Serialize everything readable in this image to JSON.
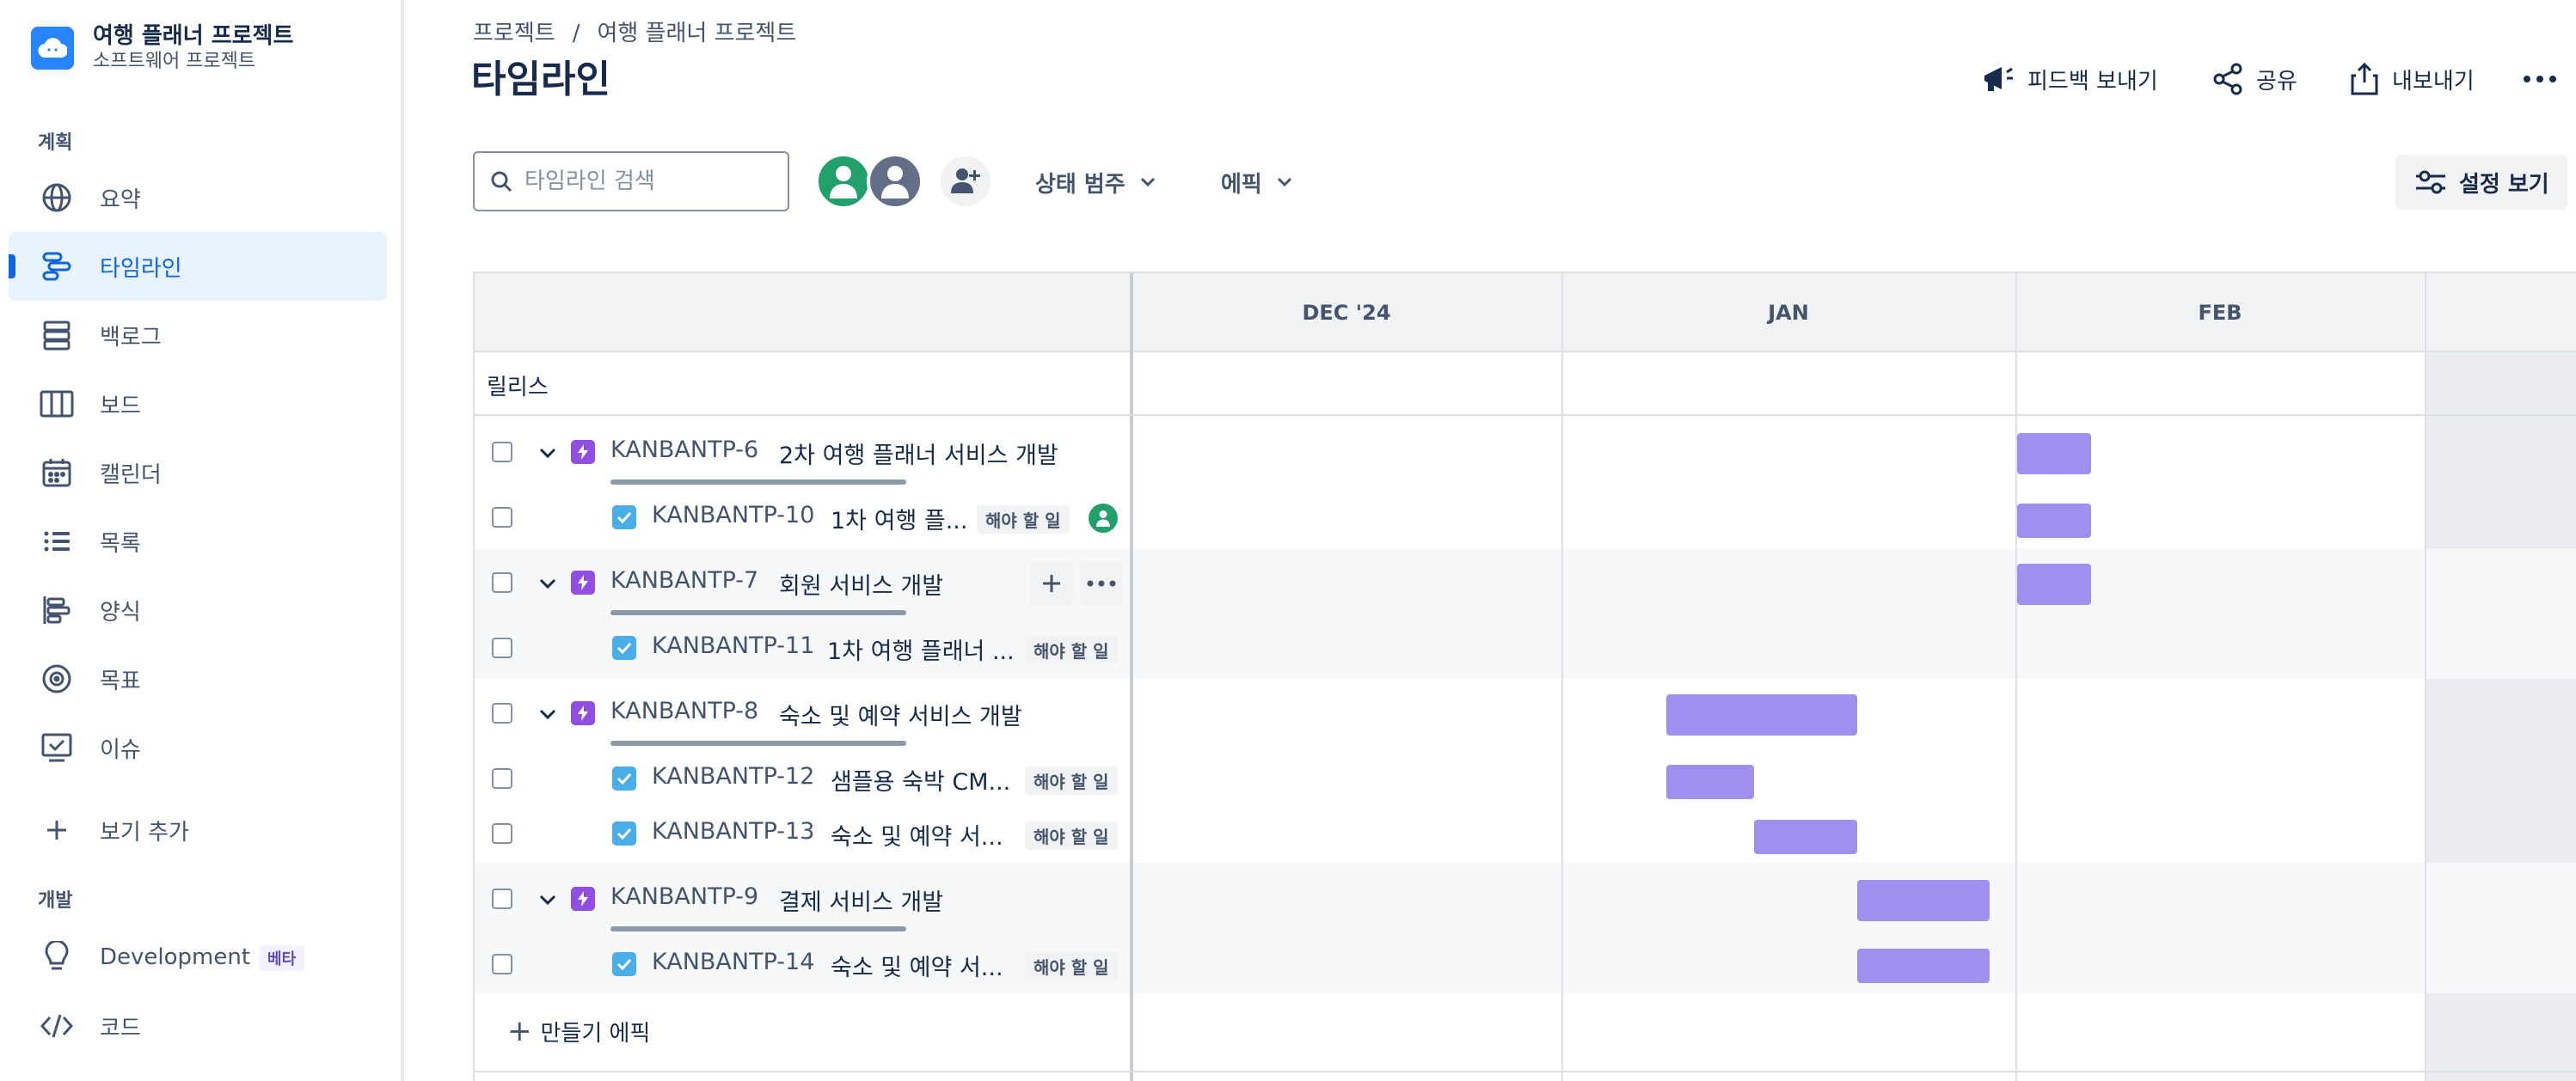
{
  "project": {
    "name": "여행 플래너 프로젝트",
    "type": "소프트웨어 프로젝트"
  },
  "sidebar": {
    "sections": {
      "plan": "계획",
      "dev": "개발"
    },
    "items": [
      {
        "label": "요약",
        "icon": "globe-icon"
      },
      {
        "label": "타임라인",
        "icon": "timeline-icon",
        "active": true
      },
      {
        "label": "백로그",
        "icon": "backlog-icon"
      },
      {
        "label": "보드",
        "icon": "board-icon"
      },
      {
        "label": "캘린더",
        "icon": "calendar-icon"
      },
      {
        "label": "목록",
        "icon": "list-icon"
      },
      {
        "label": "양식",
        "icon": "form-icon"
      },
      {
        "label": "목표",
        "icon": "target-icon"
      },
      {
        "label": "이슈",
        "icon": "issues-icon"
      }
    ],
    "add_view": "보기 추가",
    "dev_items": [
      {
        "label": "Development",
        "badge": "베타",
        "icon": "lightbulb-icon"
      },
      {
        "label": "코드",
        "icon": "code-icon"
      }
    ]
  },
  "breadcrumb": {
    "root": "프로젝트",
    "separator": "/",
    "current": "여행 플래너 프로젝트"
  },
  "page_title": "타임라인",
  "header_actions": {
    "feedback": "피드백 보내기",
    "share": "공유",
    "export": "내보내기"
  },
  "toolbar": {
    "search_placeholder": "타임라인 검색",
    "status_filter": "상태 범주",
    "epic_filter": "에픽",
    "view_settings": "설정 보기"
  },
  "timeline": {
    "months": [
      "DEC '24",
      "JAN",
      "FEB"
    ],
    "releases_label": "릴리스",
    "create_epic": "만들기 에픽",
    "colors": {
      "bar": "#9f8fef",
      "epic": "#904ee2",
      "task": "#4bade8"
    },
    "issues": [
      {
        "key": "KANBANTP-6",
        "summary": "2차 여행 플래너 서비스 개발",
        "type": "epic"
      },
      {
        "key": "KANBANTP-10",
        "summary": "1차 여행 플...",
        "type": "task",
        "status": "해야 할 일",
        "assignee": true
      },
      {
        "key": "KANBANTP-7",
        "summary": "회원 서비스 개발",
        "type": "epic",
        "hover": true
      },
      {
        "key": "KANBANTP-11",
        "summary": "1차 여행 플래너 ...",
        "type": "task",
        "status": "해야 할 일"
      },
      {
        "key": "KANBANTP-8",
        "summary": "숙소 및 예약 서비스 개발",
        "type": "epic"
      },
      {
        "key": "KANBANTP-12",
        "summary": "샘플용 숙박 CM...",
        "type": "task",
        "status": "해야 할 일"
      },
      {
        "key": "KANBANTP-13",
        "summary": "숙소 및 예약 서...",
        "type": "task",
        "status": "해야 할 일"
      },
      {
        "key": "KANBANTP-9",
        "summary": "결제 서비스 개발",
        "type": "epic"
      },
      {
        "key": "KANBANTP-14",
        "summary": "숙소 및 예약 서...",
        "type": "task",
        "status": "해야 할 일"
      }
    ]
  }
}
